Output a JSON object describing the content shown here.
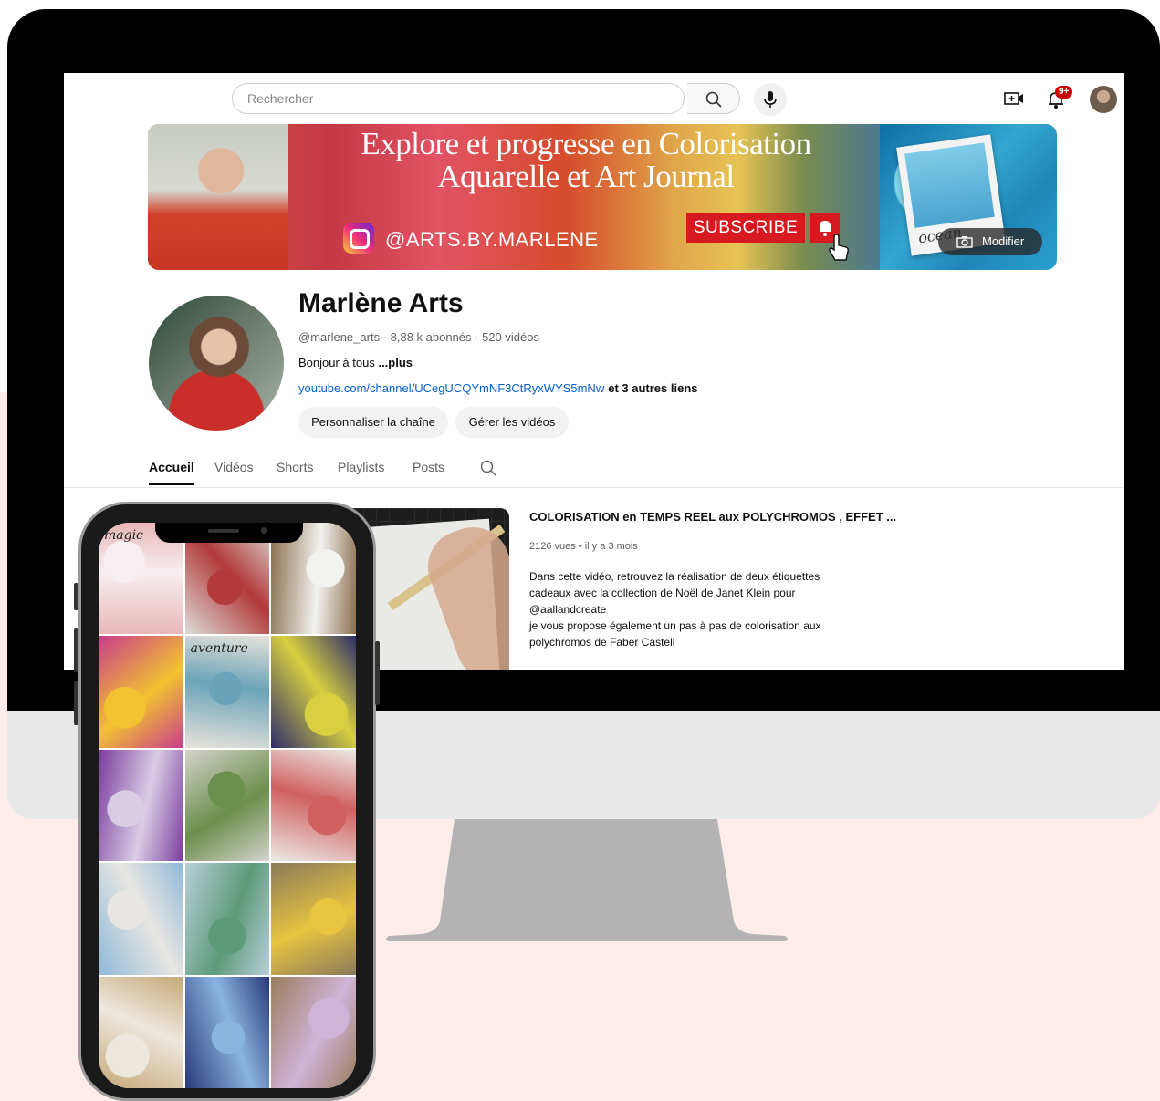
{
  "youtube": {
    "search": {
      "placeholder": "Rechercher"
    },
    "notification_count": "9+"
  },
  "banner": {
    "title_line1": "Explore et progresse en Colorisation",
    "title_line2": "Aquarelle et Art Journal",
    "instagram_handle": "@ARTS.BY.MARLENE",
    "subscribe_label": "SUBSCRIBE",
    "modify_label": "Modifier",
    "polaroid_text": "ocean"
  },
  "channel": {
    "name": "Marlène Arts",
    "meta": "@marlene_arts · 8,88 k abonnés · 520 vidéos",
    "description": "Bonjour à tous ",
    "description_more": "...plus",
    "link_url": "youtube.com/channel/UCegUCQYmNF3CtRyxWYS5mNw",
    "link_more": "et 3 autres liens",
    "customize_button": "Personnaliser la chaîne",
    "manage_button": "Gérer les vidéos"
  },
  "tabs": [
    {
      "label": "Accueil",
      "active": true
    },
    {
      "label": "Vidéos"
    },
    {
      "label": "Shorts"
    },
    {
      "label": "Playlists"
    },
    {
      "label": "Posts"
    }
  ],
  "featured_video": {
    "title": "COLORISATION en TEMPS REEL aux POLYCHROMOS , EFFET ...",
    "meta": "2126 vues • il y a 3 mois",
    "description_lines": [
      "Dans cette vidéo, retrouvez la réalisation de deux étiquettes",
      "cadeaux avec la collection de Noël de Janet Klein pour",
      "@aallandcreate",
      "je vous propose également un pas à pas de colorisation aux",
      "polychromos de Faber Castell"
    ]
  },
  "phone_grid": {
    "cell_labels": [
      "magic",
      "aventure"
    ],
    "cell_colors": [
      [
        "#e8b7b9",
        "#f6eef0"
      ],
      [
        "#dcdcd8",
        "#b23a3a"
      ],
      [
        "#8a6d4c",
        "#f2f2f0"
      ],
      [
        "#c83c8c",
        "#f2c230"
      ],
      [
        "#e7e3da",
        "#6aa3b8"
      ],
      [
        "#2c2c6a",
        "#d8d040"
      ],
      [
        "#7a3b9c",
        "#d9cde6"
      ],
      [
        "#d5d2cc",
        "#6b8f4c"
      ],
      [
        "#eceae6",
        "#d06060"
      ],
      [
        "#8fb9d8",
        "#e8e6e2"
      ],
      [
        "#b8cfd8",
        "#5d9a7a"
      ],
      [
        "#8a7a5a",
        "#e8c440"
      ],
      [
        "#c7a878",
        "#ece8de"
      ],
      [
        "#2a3a7a",
        "#8ab4e0"
      ],
      [
        "#9a7c5c",
        "#d0b4d8"
      ]
    ]
  },
  "colors": {
    "brand_red": "#d71920",
    "link_blue": "#065fd4",
    "page_pink": "#fdecea"
  }
}
